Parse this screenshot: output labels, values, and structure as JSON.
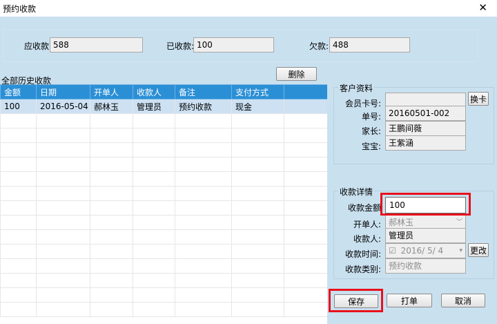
{
  "window": {
    "title": "预约收款",
    "close_glyph": "✕"
  },
  "summary": {
    "receivable_label": "应收款:",
    "receivable_value": "588",
    "received_label": "已收款:",
    "received_value": "100",
    "owed_label": "欠款:",
    "owed_value": "488"
  },
  "history": {
    "title": "全部历史收款",
    "delete_label": "删除",
    "columns": [
      "金额",
      "日期",
      "开单人",
      "收款人",
      "备注",
      "支付方式"
    ],
    "rows": [
      [
        "100",
        "2016-05-04",
        "郝林玉",
        "管理员",
        "预约收款",
        "现金"
      ]
    ]
  },
  "customer": {
    "title": "客户资料",
    "card_label": "会员卡号:",
    "card_value": "",
    "change_card_label": "换卡",
    "order_label": "单号:",
    "order_value": "20160501-002",
    "parent_label": "家长:",
    "parent_value": "王鹏间薇",
    "baby_label": "宝宝:",
    "baby_value": "王紫涵"
  },
  "payment": {
    "title": "收款详情",
    "amount_label": "收款金额",
    "amount_value": "100",
    "issuer_label": "开单人:",
    "issuer_value": "郝林玉",
    "payee_label": "收款人:",
    "payee_value": "管理员",
    "time_label": "收款时间:",
    "time_check": "☑",
    "time_value": "2016/  5/  4",
    "change_label": "更改",
    "type_label": "收款类别:",
    "type_value": "预约收款"
  },
  "actions": {
    "save_label": "保存",
    "print_label": "打单",
    "cancel_label": "取消"
  },
  "colors": {
    "header_blue": "#2b8fd6",
    "highlight_red": "#e8111b",
    "panel_bg": "#c9e0ef"
  }
}
